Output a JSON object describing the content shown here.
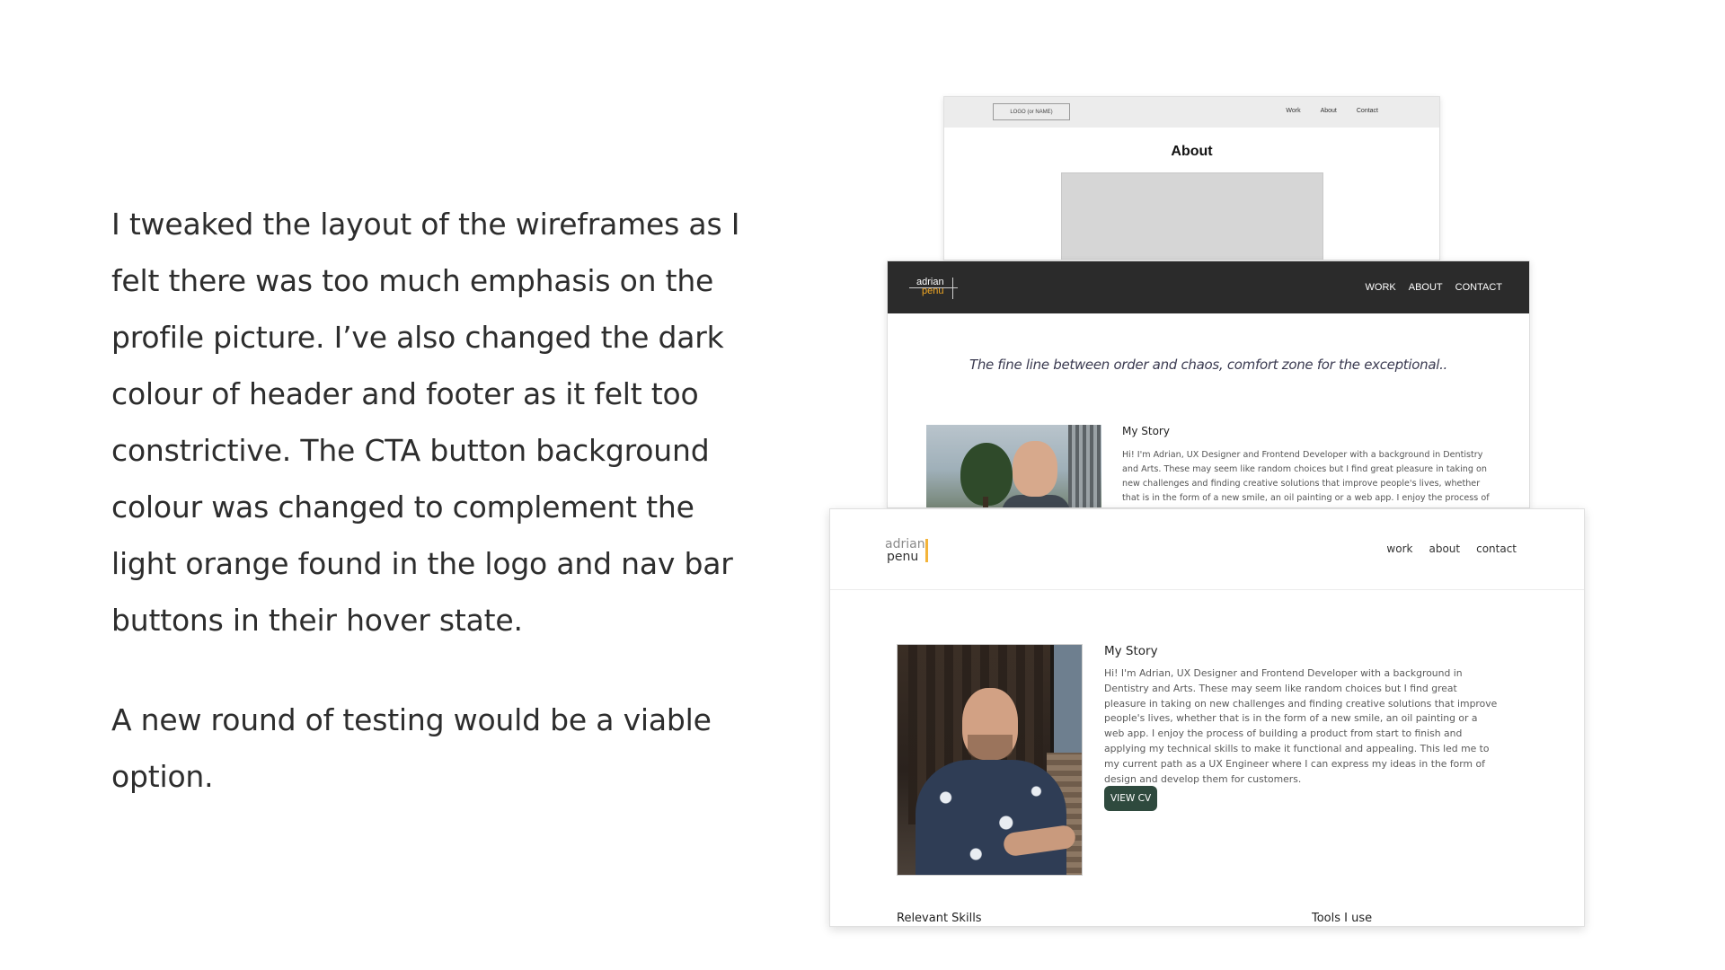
{
  "copy": {
    "paragraph_1": "I tweaked the layout of the wireframes as I felt there was too much emphasis on the profile picture. I’ve also changed the dark colour of header and footer as it felt too constrictive. The CTA button background colour was changed to complement the light orange found in the logo and nav bar buttons in their hover state.",
    "paragraph_2": "A new round of testing would be a viable option."
  },
  "wireframe": {
    "logo_placeholder": "LOGO (or NAME)",
    "nav": [
      "Work",
      "About",
      "Contact"
    ],
    "page_title": "About"
  },
  "first_iteration": {
    "logo_line_1": "adrian",
    "logo_line_2": "penu",
    "nav": [
      "WORK",
      "ABOUT",
      "CONTACT"
    ],
    "tagline": "The fine line between order and chaos, comfort zone for the exceptional..",
    "story_title": "My Story",
    "story_text": "Hi! I'm Adrian, UX Designer and Frontend Developer with a background in Dentistry and Arts. These may seem like random choices but I find great pleasure in taking on new challenges and finding creative solutions that improve people's lives, whether that is in the form of a new smile, an oil painting or a web app. I enjoy the process of"
  },
  "final_design": {
    "logo_line_1": "adrian",
    "logo_line_2": "penu",
    "nav": [
      "work",
      "about",
      "contact"
    ],
    "story_title": "My Story",
    "story_text": "Hi! I'm Adrian, UX Designer and Frontend Developer with a background in Dentistry and Arts. These may seem like random choices but I find great pleasure in taking on new challenges and finding creative solutions that improve people's lives, whether that is in the form of a new smile, an oil painting or a web app. I enjoy the process of building a product from start to finish and applying my technical skills to make it functional and appealing. This led me to my current path as a UX Engineer where I can express my ideas in the form of design and develop them for customers.",
    "cta_label": "VIEW CV",
    "skills_heading": "Relevant Skills",
    "tools_heading": "Tools I use"
  },
  "colors": {
    "dark_header": "#2b2b2b",
    "logo_orange": "#f3a823",
    "cta_background": "#2f4a3e"
  }
}
